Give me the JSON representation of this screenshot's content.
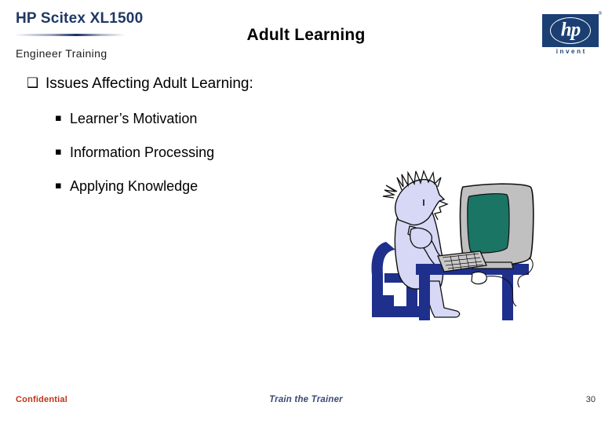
{
  "header": {
    "product_title": "HP Scitex XL1500",
    "course_title": "Engineer  Training",
    "slide_title": "Adult Learning",
    "logo": {
      "letters": "hp",
      "tagline": "invent",
      "trademark": "®"
    }
  },
  "body": {
    "bullets": [
      {
        "level": 1,
        "marker": "❑",
        "marker_name": "hollow-square-bullet",
        "text": "Issues Affecting Adult Learning:"
      },
      {
        "level": 2,
        "marker": "▪",
        "marker_name": "filled-square-bullet",
        "text": "Learner’s Motivation"
      },
      {
        "level": 2,
        "marker": "▪",
        "marker_name": "filled-square-bullet",
        "text": "Information Processing"
      },
      {
        "level": 2,
        "marker": "▪",
        "marker_name": "filled-square-bullet",
        "text": "Applying Knowledge"
      }
    ]
  },
  "illustration": {
    "name": "frustrated-person-at-computer-clipart",
    "description": "Cartoon of a person with spiky hair seated on a chair at a desk using a desktop computer",
    "colors": {
      "figure": "#d6d8f5",
      "furniture": "#1f2f8c",
      "monitor_body": "#c0c0c0",
      "monitor_screen": "#1a7565",
      "outline": "#000000"
    }
  },
  "footer": {
    "confidential": "Confidential",
    "center_text": "Train the Trainer",
    "page_number": "30"
  },
  "colors": {
    "header_accent": "#1b3566",
    "hp_blue": "#1b3f72",
    "confidential_red": "#bf3317",
    "footer_navy": "#394a74",
    "product_title_navy": "#1f3864"
  }
}
